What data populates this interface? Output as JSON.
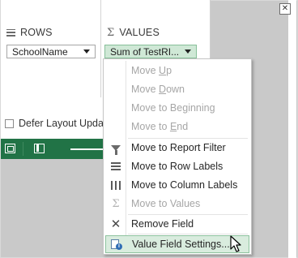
{
  "rows_area": {
    "title": "ROWS",
    "field_label": "SchoolName"
  },
  "values_area": {
    "title": "VALUES",
    "field_label": "Sum of TestRI..."
  },
  "defer": {
    "label": "Defer Layout Update"
  },
  "context_menu": {
    "items": [
      {
        "label": "Move Up",
        "underline": "U",
        "before": "Move ",
        "after": "p",
        "enabled": false,
        "icon": "none"
      },
      {
        "label": "Move Down",
        "underline": "D",
        "before": "Move ",
        "after": "own",
        "enabled": false,
        "icon": "none"
      },
      {
        "label": "Move to Beginning",
        "underline": "g",
        "before": "Move to Be",
        "after": "inning",
        "enabled": false,
        "icon": "none"
      },
      {
        "label": "Move to End",
        "underline": "E",
        "before": "Move to ",
        "after": "nd",
        "enabled": false,
        "icon": "none"
      },
      {
        "label": "Move to Report Filter",
        "enabled": true,
        "icon": "filter-icon"
      },
      {
        "label": "Move to Row Labels",
        "enabled": true,
        "icon": "rows-icon"
      },
      {
        "label": "Move to Column Labels",
        "enabled": true,
        "icon": "columns-icon"
      },
      {
        "label": "Move to Values",
        "enabled": false,
        "icon": "sigma-icon"
      },
      {
        "label": "Remove Field",
        "enabled": true,
        "icon": "remove-icon"
      },
      {
        "label": "Value Field Settings...",
        "enabled": true,
        "highlighted": true,
        "icon": "value-field-settings-icon"
      }
    ]
  },
  "colors": {
    "status_bar": "#217346",
    "value_pill_bg": "#cfe8d6",
    "menu_highlight": "#d9ecde",
    "disabled_text": "#a6a6a6"
  }
}
